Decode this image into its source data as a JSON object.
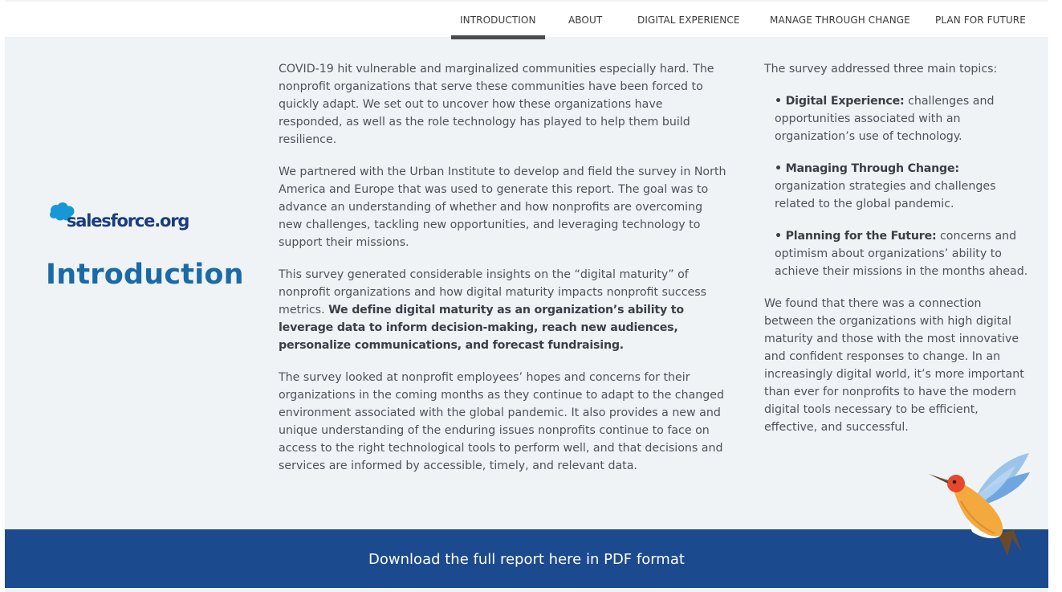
{
  "nav": {
    "items": [
      {
        "label": "INTRODUCTION"
      },
      {
        "label": "ABOUT"
      },
      {
        "label": "DIGITAL EXPERIENCE"
      },
      {
        "label": "MANAGE THROUGH CHANGE"
      },
      {
        "label": "PLAN FOR FUTURE"
      }
    ]
  },
  "brand": {
    "logo_text": "salesforce.org"
  },
  "page_title": "Introduction",
  "middle": {
    "p1": "COVID-19 hit vulnerable and marginalized communities especially hard. The nonprofit organizations that serve these communities have been forced to quickly adapt. We set out to uncover how these organizations have responded, as well as the role technology has played to help them build resilience.",
    "p2": "We partnered with the Urban Institute to develop and field the survey in North America and Europe that was used to generate this report. The goal was to advance an understanding of whether and how nonprofits are overcoming new challenges, tackling new opportunities, and leveraging technology to support their missions.",
    "p3_a": "This survey generated considerable insights on the “digital maturity” of nonprofit organizations and how digital maturity impacts nonprofit success metrics.",
    "p3_b": "We define digital maturity as an organization’s ability to leverage data to inform decision-making, reach new audiences, personalize communications, and forecast fundraising.",
    "p4": "The survey looked at nonprofit employees’ hopes and concerns for their organizations in the coming months as they continue to adapt to the changed environment associated with the global pandemic. It also provides a new and unique understanding of the enduring issues nonprofits continue to face on access to the right technological tools to perform well, and that decisions and services are informed by accessible, timely, and relevant data."
  },
  "right": {
    "intro": "The survey addressed three main topics:",
    "topics": [
      {
        "title": "• Digital Experience:",
        "text": "challenges and opportunities associated with an organization’s use of technology."
      },
      {
        "title": "• Managing Through Change:",
        "text": "organization strategies and challenges related to the global pandemic."
      },
      {
        "title": "• Planning for the Future:",
        "text": "concerns and optimism about organizations’ ability to achieve their missions in the months ahead."
      }
    ],
    "conclusion": "We found that there was a connection between the organizations with high digital maturity and those with the most innovative and confident responses to change. In an increasingly digital world, it’s more important than ever for nonprofits to have the modern digital tools necessary to be efficient, effective, and successful."
  },
  "banner": {
    "label": "Download the full report here in PDF format"
  },
  "colors": {
    "title_blue": "#1a6aa6",
    "banner_navy": "#1b4a8f",
    "logo_cloud": "#1798d6",
    "background": "#f0f3f6"
  },
  "icons": {
    "logo": "salesforce-cloud-icon",
    "decoration": "hummingbird-illustration"
  }
}
